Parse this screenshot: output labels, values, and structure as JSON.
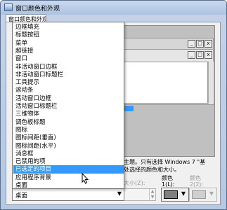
{
  "window": {
    "title": "窗口颜色和外观",
    "tab": "窗口颜色和外观"
  },
  "preview": {
    "window_buttons": [
      "_",
      "□",
      "x"
    ]
  },
  "dropdown": {
    "items": [
      "边框填充",
      "标题按钮",
      "菜单",
      "超链接",
      "窗口",
      "非活动窗口边框",
      "非活动窗口标题栏",
      "工具提示",
      "滚动条",
      "活动窗口边框",
      "活动窗口标题栏",
      "三维物体",
      "调色板标题",
      "图标",
      "图标间距(垂直)",
      "图标间距(水平)",
      "消息框",
      "已禁用的项",
      "已选定的项目",
      "应用程序背景",
      "桌面"
    ],
    "selected_index": 18
  },
  "description": {
    "line1": "主题。只有选择 Windows 7 \"基",
    "line2": "处选择的颜色和大小。"
  },
  "controls": {
    "item_combo_value": "桌面",
    "size_label": "大小(Z):",
    "color1_label": "颜色",
    "color1_sub": "1(L):",
    "color2_label": "颜色",
    "color2_sub": "2(2):",
    "color1_swatch": "#808080",
    "color2_swatch": "#cfcfcf"
  }
}
